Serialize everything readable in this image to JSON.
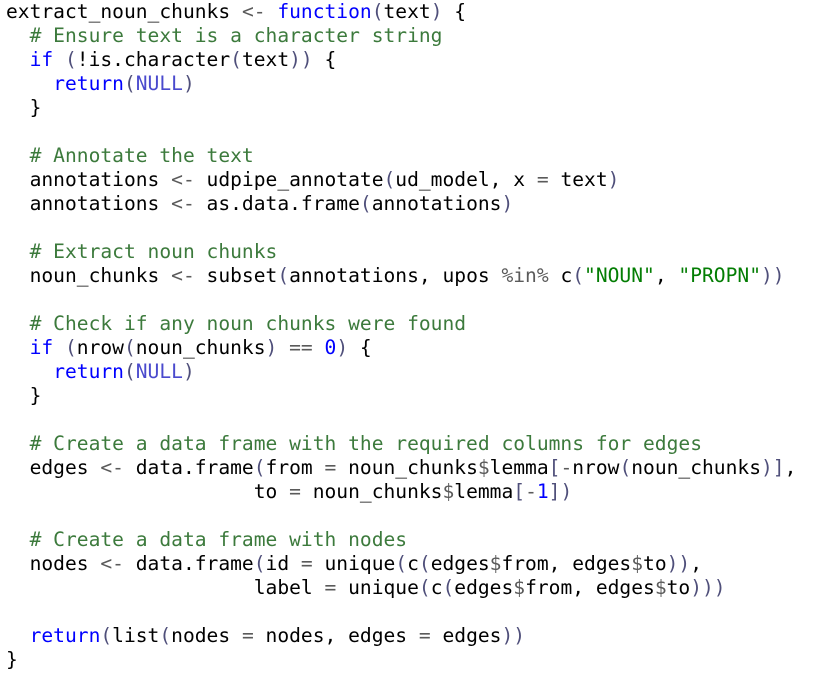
{
  "editor": {
    "colors": {
      "text": "#000000",
      "comment": "#3c7a3c",
      "keyword": "#0000ff",
      "constant": "#4a4acd",
      "string": "#037d03",
      "number": "#0000ff",
      "bracket": "#4f4f7a",
      "operator": "#5a5a5a",
      "background": "#ffffff"
    },
    "lines": [
      [
        [
          "text",
          "extract_noun_chunks "
        ],
        [
          "operator",
          "<-"
        ],
        [
          "text",
          " "
        ],
        [
          "keyword",
          "function"
        ],
        [
          "bracket",
          "("
        ],
        [
          "text",
          "text"
        ],
        [
          "bracket",
          ")"
        ],
        [
          "text",
          " {"
        ]
      ],
      [
        [
          "text",
          "  "
        ],
        [
          "comment",
          "# Ensure text is a character string"
        ]
      ],
      [
        [
          "text",
          "  "
        ],
        [
          "keyword",
          "if"
        ],
        [
          "text",
          " "
        ],
        [
          "bracket",
          "("
        ],
        [
          "text",
          "!is.character"
        ],
        [
          "bracket",
          "("
        ],
        [
          "text",
          "text"
        ],
        [
          "bracket",
          "))"
        ],
        [
          "text",
          " {"
        ]
      ],
      [
        [
          "text",
          "    "
        ],
        [
          "keyword",
          "return"
        ],
        [
          "bracket",
          "("
        ],
        [
          "constant",
          "NULL"
        ],
        [
          "bracket",
          ")"
        ]
      ],
      [
        [
          "text",
          "  }"
        ]
      ],
      [],
      [
        [
          "text",
          "  "
        ],
        [
          "comment",
          "# Annotate the text"
        ]
      ],
      [
        [
          "text",
          "  annotations "
        ],
        [
          "operator",
          "<-"
        ],
        [
          "text",
          " udpipe_annotate"
        ],
        [
          "bracket",
          "("
        ],
        [
          "text",
          "ud_model, x "
        ],
        [
          "operator",
          "="
        ],
        [
          "text",
          " text"
        ],
        [
          "bracket",
          ")"
        ]
      ],
      [
        [
          "text",
          "  annotations "
        ],
        [
          "operator",
          "<-"
        ],
        [
          "text",
          " as.data.frame"
        ],
        [
          "bracket",
          "("
        ],
        [
          "text",
          "annotations"
        ],
        [
          "bracket",
          ")"
        ]
      ],
      [],
      [
        [
          "text",
          "  "
        ],
        [
          "comment",
          "# Extract noun chunks"
        ]
      ],
      [
        [
          "text",
          "  noun_chunks "
        ],
        [
          "operator",
          "<-"
        ],
        [
          "text",
          " subset"
        ],
        [
          "bracket",
          "("
        ],
        [
          "text",
          "annotations, upos "
        ],
        [
          "operator",
          "%in%"
        ],
        [
          "text",
          " c"
        ],
        [
          "bracket",
          "("
        ],
        [
          "string",
          "\"NOUN\""
        ],
        [
          "text",
          ", "
        ],
        [
          "string",
          "\"PROPN\""
        ],
        [
          "bracket",
          "))"
        ]
      ],
      [],
      [
        [
          "text",
          "  "
        ],
        [
          "comment",
          "# Check if any noun chunks were found"
        ]
      ],
      [
        [
          "text",
          "  "
        ],
        [
          "keyword",
          "if"
        ],
        [
          "text",
          " "
        ],
        [
          "bracket",
          "("
        ],
        [
          "text",
          "nrow"
        ],
        [
          "bracket",
          "("
        ],
        [
          "text",
          "noun_chunks"
        ],
        [
          "bracket",
          ")"
        ],
        [
          "text",
          " "
        ],
        [
          "operator",
          "=="
        ],
        [
          "text",
          " "
        ],
        [
          "number",
          "0"
        ],
        [
          "bracket",
          ")"
        ],
        [
          "text",
          " {"
        ]
      ],
      [
        [
          "text",
          "    "
        ],
        [
          "keyword",
          "return"
        ],
        [
          "bracket",
          "("
        ],
        [
          "constant",
          "NULL"
        ],
        [
          "bracket",
          ")"
        ]
      ],
      [
        [
          "text",
          "  }"
        ]
      ],
      [],
      [
        [
          "text",
          "  "
        ],
        [
          "comment",
          "# Create a data frame with the required columns for edges"
        ]
      ],
      [
        [
          "text",
          "  edges "
        ],
        [
          "operator",
          "<-"
        ],
        [
          "text",
          " data.frame"
        ],
        [
          "bracket",
          "("
        ],
        [
          "text",
          "from "
        ],
        [
          "operator",
          "="
        ],
        [
          "text",
          " noun_chunks"
        ],
        [
          "operator",
          "$"
        ],
        [
          "text",
          "lemma"
        ],
        [
          "bracket",
          "["
        ],
        [
          "operator",
          "-"
        ],
        [
          "text",
          "nrow"
        ],
        [
          "bracket",
          "("
        ],
        [
          "text",
          "noun_chunks"
        ],
        [
          "bracket",
          ")]"
        ],
        [
          "text",
          ","
        ]
      ],
      [
        [
          "text",
          "                     to "
        ],
        [
          "operator",
          "="
        ],
        [
          "text",
          " noun_chunks"
        ],
        [
          "operator",
          "$"
        ],
        [
          "text",
          "lemma"
        ],
        [
          "bracket",
          "["
        ],
        [
          "operator",
          "-"
        ],
        [
          "number",
          "1"
        ],
        [
          "bracket",
          "])"
        ]
      ],
      [],
      [
        [
          "text",
          "  "
        ],
        [
          "comment",
          "# Create a data frame with nodes"
        ]
      ],
      [
        [
          "text",
          "  nodes "
        ],
        [
          "operator",
          "<-"
        ],
        [
          "text",
          " data.frame"
        ],
        [
          "bracket",
          "("
        ],
        [
          "text",
          "id "
        ],
        [
          "operator",
          "="
        ],
        [
          "text",
          " unique"
        ],
        [
          "bracket",
          "("
        ],
        [
          "text",
          "c"
        ],
        [
          "bracket",
          "("
        ],
        [
          "text",
          "edges"
        ],
        [
          "operator",
          "$"
        ],
        [
          "text",
          "from, edges"
        ],
        [
          "operator",
          "$"
        ],
        [
          "text",
          "to"
        ],
        [
          "bracket",
          "))"
        ],
        [
          "text",
          ","
        ]
      ],
      [
        [
          "text",
          "                     label "
        ],
        [
          "operator",
          "="
        ],
        [
          "text",
          " unique"
        ],
        [
          "bracket",
          "("
        ],
        [
          "text",
          "c"
        ],
        [
          "bracket",
          "("
        ],
        [
          "text",
          "edges"
        ],
        [
          "operator",
          "$"
        ],
        [
          "text",
          "from, edges"
        ],
        [
          "operator",
          "$"
        ],
        [
          "text",
          "to"
        ],
        [
          "bracket",
          ")))"
        ]
      ],
      [],
      [
        [
          "text",
          "  "
        ],
        [
          "keyword",
          "return"
        ],
        [
          "bracket",
          "("
        ],
        [
          "text",
          "list"
        ],
        [
          "bracket",
          "("
        ],
        [
          "text",
          "nodes "
        ],
        [
          "operator",
          "="
        ],
        [
          "text",
          " nodes, edges "
        ],
        [
          "operator",
          "="
        ],
        [
          "text",
          " edges"
        ],
        [
          "bracket",
          "))"
        ]
      ],
      [
        [
          "text",
          "}"
        ]
      ]
    ]
  }
}
